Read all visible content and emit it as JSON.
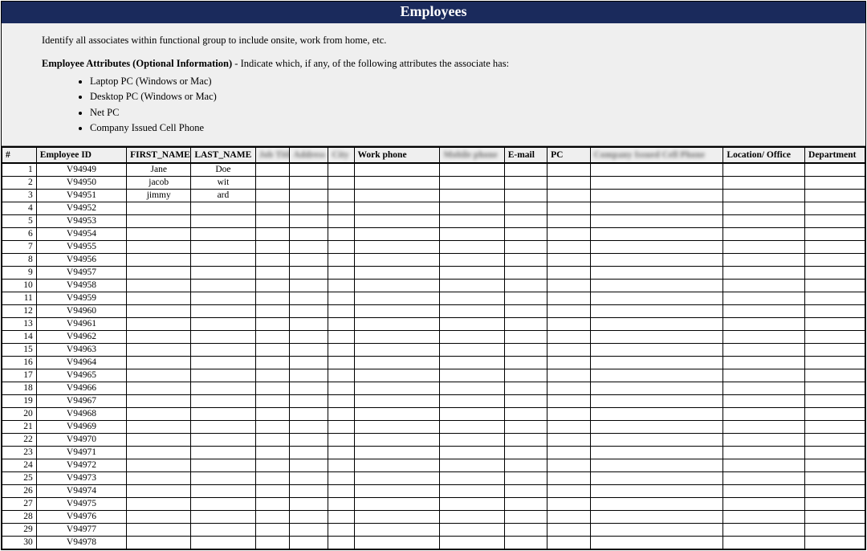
{
  "title": "Employees",
  "intro": {
    "lead": "Identify all associates within functional group to include onsite, work from home, etc.",
    "attr_head_bold": "Employee Attributes (Optional Information)",
    "attr_head_rest": " - Indicate which, if any, of the following attributes the associate has:",
    "bullets": [
      "Laptop PC (Windows or Mac)",
      "Desktop PC (Windows or Mac)",
      "Net PC",
      "Company Issued Cell Phone"
    ]
  },
  "columns": {
    "num": "#",
    "emp_id": "Employee ID",
    "first": "FIRST_NAME",
    "last": "LAST_NAME",
    "blur_a": "Job Title",
    "blur_b": "Address",
    "blur_c": "City",
    "work_phone": "Work phone",
    "blur_d": "Mobile phone",
    "email": "E-mail",
    "pc": "PC",
    "blur_e": "Company Issued Cell Phone",
    "location": "Location/ Office",
    "dept": "Department"
  },
  "rows": [
    {
      "n": "1",
      "id": "V94949",
      "first": "Jane",
      "last": "Doe"
    },
    {
      "n": "2",
      "id": "V94950",
      "first": "jacob",
      "last": "wit"
    },
    {
      "n": "3",
      "id": "V94951",
      "first": "jimmy",
      "last": "ard"
    },
    {
      "n": "4",
      "id": "V94952",
      "first": "",
      "last": ""
    },
    {
      "n": "5",
      "id": "V94953",
      "first": "",
      "last": ""
    },
    {
      "n": "6",
      "id": "V94954",
      "first": "",
      "last": ""
    },
    {
      "n": "7",
      "id": "V94955",
      "first": "",
      "last": ""
    },
    {
      "n": "8",
      "id": "V94956",
      "first": "",
      "last": ""
    },
    {
      "n": "9",
      "id": "V94957",
      "first": "",
      "last": ""
    },
    {
      "n": "10",
      "id": "V94958",
      "first": "",
      "last": ""
    },
    {
      "n": "11",
      "id": "V94959",
      "first": "",
      "last": ""
    },
    {
      "n": "12",
      "id": "V94960",
      "first": "",
      "last": ""
    },
    {
      "n": "13",
      "id": "V94961",
      "first": "",
      "last": ""
    },
    {
      "n": "14",
      "id": "V94962",
      "first": "",
      "last": ""
    },
    {
      "n": "15",
      "id": "V94963",
      "first": "",
      "last": ""
    },
    {
      "n": "16",
      "id": "V94964",
      "first": "",
      "last": ""
    },
    {
      "n": "17",
      "id": "V94965",
      "first": "",
      "last": ""
    },
    {
      "n": "18",
      "id": "V94966",
      "first": "",
      "last": ""
    },
    {
      "n": "19",
      "id": "V94967",
      "first": "",
      "last": ""
    },
    {
      "n": "20",
      "id": "V94968",
      "first": "",
      "last": ""
    },
    {
      "n": "21",
      "id": "V94969",
      "first": "",
      "last": ""
    },
    {
      "n": "22",
      "id": "V94970",
      "first": "",
      "last": ""
    },
    {
      "n": "23",
      "id": "V94971",
      "first": "",
      "last": ""
    },
    {
      "n": "24",
      "id": "V94972",
      "first": "",
      "last": ""
    },
    {
      "n": "25",
      "id": "V94973",
      "first": "",
      "last": ""
    },
    {
      "n": "26",
      "id": "V94974",
      "first": "",
      "last": ""
    },
    {
      "n": "27",
      "id": "V94975",
      "first": "",
      "last": ""
    },
    {
      "n": "28",
      "id": "V94976",
      "first": "",
      "last": ""
    },
    {
      "n": "29",
      "id": "V94977",
      "first": "",
      "last": ""
    },
    {
      "n": "30",
      "id": "V94978",
      "first": "",
      "last": ""
    }
  ]
}
